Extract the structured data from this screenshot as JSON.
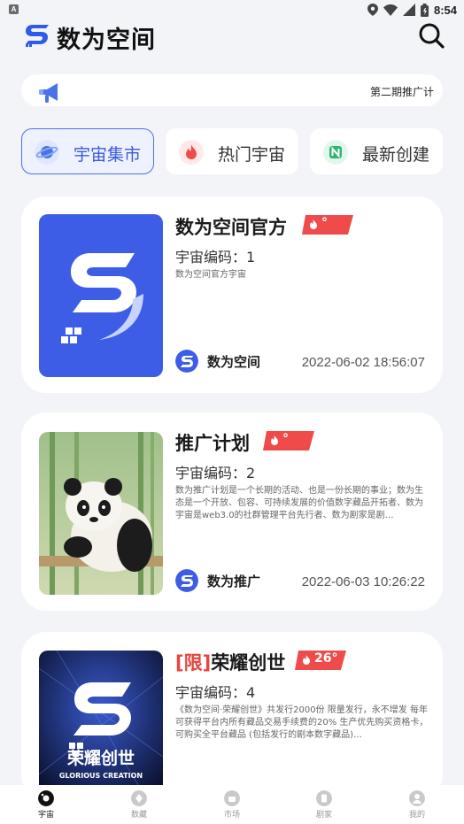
{
  "status_bar": {
    "time": "8:54",
    "left_icon": "A",
    "icons": [
      "location-icon",
      "wifi-icon",
      "signal-icon",
      "battery-icon"
    ]
  },
  "header": {
    "title": "数为空间",
    "logo": "app-logo",
    "search_icon": "search-icon"
  },
  "notice": {
    "icon": "megaphone-icon",
    "text": "第二期推广计"
  },
  "tabs": [
    {
      "label": "宇宙集市",
      "icon": "planet-icon",
      "active": true
    },
    {
      "label": "热门宇宙",
      "icon": "flame-icon",
      "active": false
    },
    {
      "label": "最新创建",
      "icon": "new-icon",
      "active": false
    }
  ],
  "cards": [
    {
      "title": "数为空间官方",
      "limited": "",
      "hot": "°",
      "code": "宇宙编码：1",
      "desc": "数为空间官方宇宙",
      "creator": "数为空间",
      "date": "2022-06-02 18:56:07"
    },
    {
      "title": "推广计划",
      "limited": "",
      "hot": "°",
      "code": "宇宙编码：2",
      "desc": "数为推广计划是一个长期的活动、也是一份长期的事业；数为生态是一个开放、包容、可持续发展的价值数字藏品开拓者、数为宇宙是web3.0的社群管理平台先行者、数为剧家是剧…",
      "creator": "数为推广",
      "date": "2022-06-03 10:26:22"
    },
    {
      "title": "荣耀创世",
      "limited": "[限]",
      "hot": "26°",
      "code": "宇宙编码：4",
      "desc": "《数为空间·荣耀创世》共发行2000份 限量发行，永不增发 每年可获得平台内所有藏品交易手续费的20% 生产优先购买资格卡，可购买全平台藏品 (包括发行的剧本数字藏品)…",
      "thumb_text": "荣耀创世",
      "thumb_subtext": "GLORIOUS CREATION",
      "creator": "",
      "date": ""
    }
  ],
  "bottom_nav": [
    {
      "label": "宇宙",
      "active": true
    },
    {
      "label": "数藏",
      "active": false
    },
    {
      "label": "市场",
      "active": false
    },
    {
      "label": "剧家",
      "active": false
    },
    {
      "label": "我的",
      "active": false
    }
  ],
  "colors": {
    "accent": "#3b5bdb",
    "hot": "#ef4b4b",
    "background": "#f3f4f8"
  }
}
